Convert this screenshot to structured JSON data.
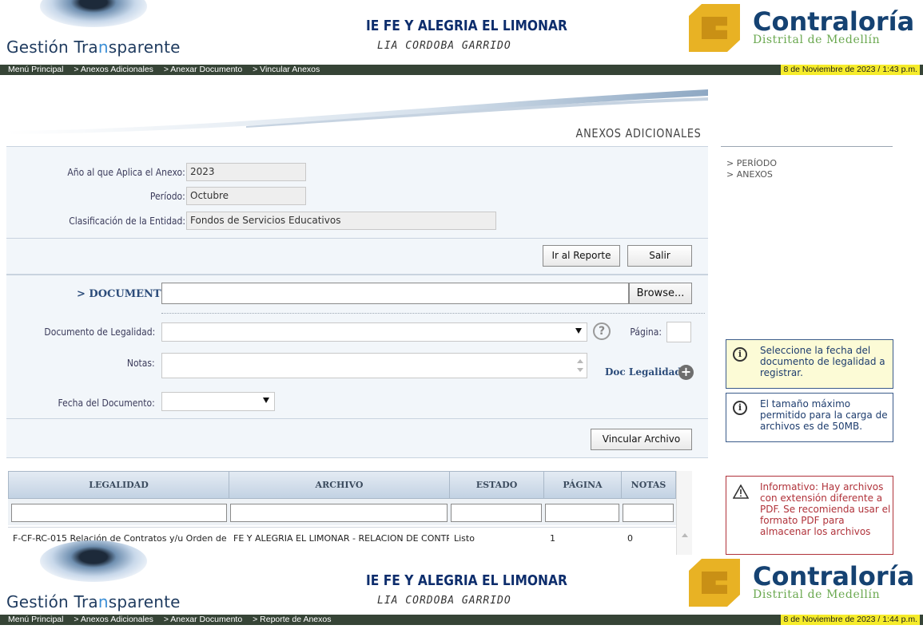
{
  "header": {
    "brand_prefix": "Gestión Tra",
    "brand_highlight": "n",
    "brand_suffix": "sparente",
    "institution": "IE FE Y ALEGRIA EL LIMONAR",
    "user": "LIA CORDOBA GARRIDO",
    "contraloria_name": "Contraloría",
    "contraloria_sub": "Distrital de Medellín"
  },
  "nav_top": {
    "crumbs": [
      "Menú Principal",
      "> Anexos Adicionales",
      "> Anexar Documento",
      "> Vincular Anexos"
    ],
    "datetime": "8 de Noviembre de 2023 / 1:43 p.m."
  },
  "nav_bottom": {
    "crumbs": [
      "Menú Principal",
      "> Anexos Adicionales",
      "> Anexar Documento",
      "> Reporte de Anexos"
    ],
    "datetime": "8 de Noviembre de 2023 / 1:44 p.m."
  },
  "section_title": "ANEXOS ADICIONALES",
  "info": {
    "anio_label": "Año al que Aplica el Anexo:",
    "anio_value": "2023",
    "periodo_label": "Período:",
    "periodo_value": "Octubre",
    "clasif_label": "Clasificación de la Entidad:",
    "clasif_value": "Fondos de Servicios Educativos"
  },
  "buttons": {
    "ir_reporte": "Ir al Reporte",
    "salir": "Salir",
    "browse": "Browse...",
    "vincular": "Vincular Archivo"
  },
  "form": {
    "documento_label": "> DOCUMENTO",
    "legalidad_label": "Documento de Legalidad:",
    "legalidad_value": "",
    "pagina_label": "Página:",
    "pagina_value": "",
    "notas_label": "Notas:",
    "notas_value": "",
    "doc_legalidad_link": "Doc Legalidad",
    "fecha_label": "Fecha del Documento:",
    "fecha_value": ""
  },
  "table": {
    "headers": [
      "LEGALIDAD",
      "ARCHIVO",
      "ESTADO",
      "PÁGINA",
      "NOTAS"
    ],
    "rows": [
      [
        "F-CF-RC-015 Relación de Contratos y/u Orden de",
        "FE Y ALEGRIA EL LIMONAR - RELACION DE CONTRATOS",
        "Listo",
        "1",
        "0"
      ]
    ]
  },
  "sidebar": {
    "links": [
      "> PERÍODO",
      "> ANEXOS"
    ],
    "note_fecha": "Seleccione la fecha del documento de legalidad a registrar.",
    "note_tamano": "El tamaño máximo permitido para la carga de archivos es de 50MB.",
    "note_info": "Informativo: Hay archivos con extensión diferente a PDF. Se recomienda usar el formato PDF para almacenar los archivos"
  },
  "colors": {
    "navbar": "#364436",
    "datetime_bg": "#f6ec2b",
    "title_blue": "#0d2d6c",
    "panel_bg": "#f2f6fa",
    "warn_red": "#b0323a"
  }
}
